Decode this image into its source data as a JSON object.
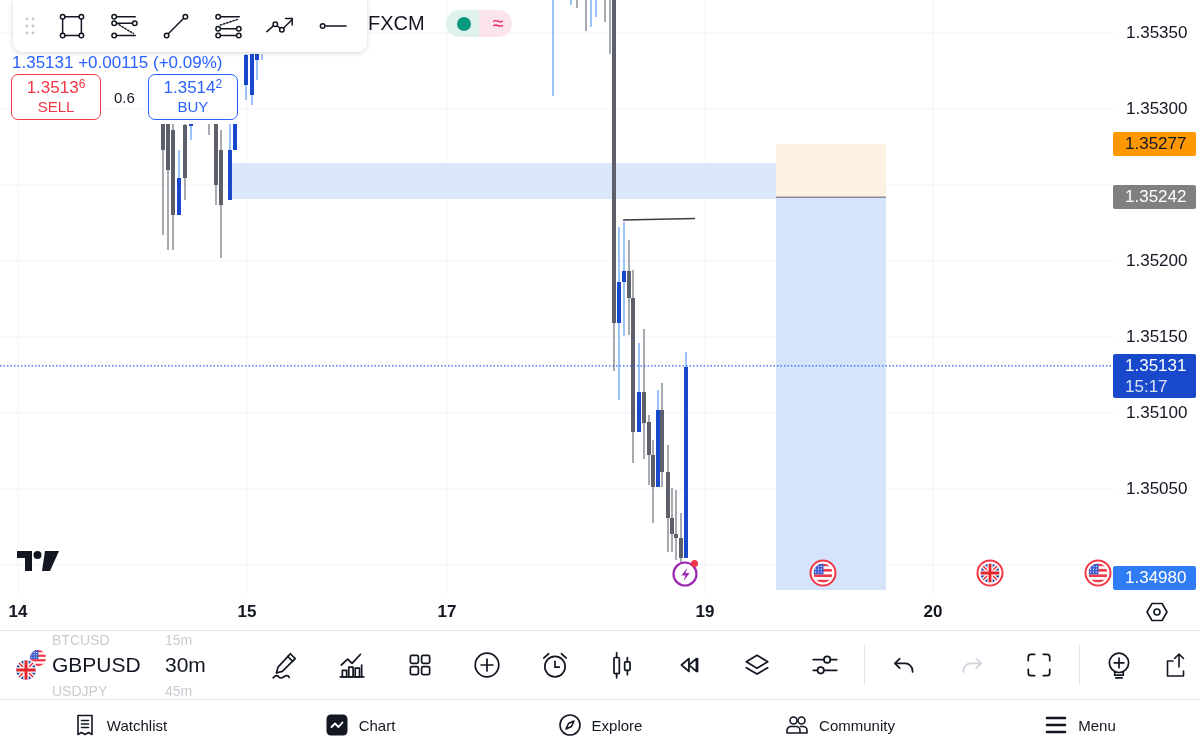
{
  "header": {
    "source": "FXCM",
    "status": {
      "symbol": "≈"
    }
  },
  "quote": {
    "last": "1.35131",
    "change": "+0.00115 (+0.09%)"
  },
  "trade": {
    "sell": {
      "price": "1.3513$^{6}$",
      "label": "SELL"
    },
    "spread": "0.6",
    "buy": {
      "price": "1.3514$^{2}$",
      "label": "BUY"
    }
  },
  "price_axis": {
    "ticks": [
      "1.35350",
      "1.35300",
      "1.35200",
      "1.35150",
      "1.35100",
      "1.35050"
    ],
    "tags": [
      {
        "kind": "top",
        "value": "1.35277",
        "color": "#ff9800"
      },
      {
        "kind": "middle",
        "value": "1.35242",
        "color": "#808080"
      },
      {
        "kind": "last",
        "value": "1.35131",
        "countdown": "15:17",
        "color": "#1848cc"
      },
      {
        "kind": "bottom",
        "value": "1.34980",
        "color": "#2f7cf6"
      }
    ]
  },
  "time_axis": {
    "labels": [
      "14",
      "15",
      "17",
      "19",
      "20"
    ]
  },
  "symbol_picker": {
    "items": [
      {
        "symbol": "BTCUSD",
        "interval": "15m",
        "selected": false
      },
      {
        "symbol": "GBPUSD",
        "interval": "30m",
        "selected": true
      },
      {
        "symbol": "USDJPY",
        "interval": "45m",
        "selected": false
      }
    ]
  },
  "history": [
    {
      "disabled": false
    },
    {
      "disabled": true
    }
  ],
  "nav": [
    {
      "label": "Watchlist",
      "selected": false
    },
    {
      "label": "Chart",
      "selected": true
    },
    {
      "label": "Explore",
      "selected": false
    },
    {
      "label": "Community",
      "selected": false
    },
    {
      "label": "Menu",
      "selected": false
    }
  ]
}
